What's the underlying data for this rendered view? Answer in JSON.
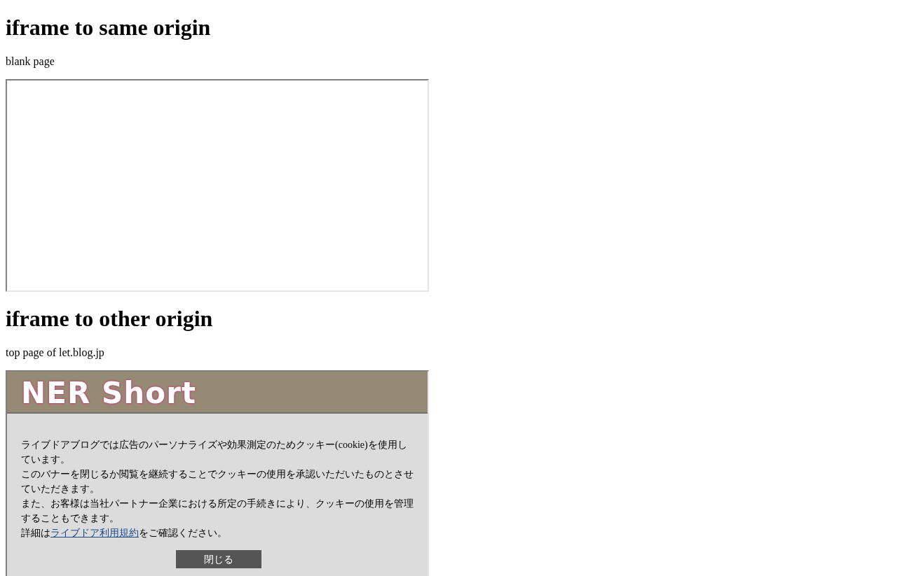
{
  "sections": [
    {
      "heading": "iframe to same origin",
      "caption": "blank page",
      "frame": {
        "kind": "blank"
      }
    },
    {
      "heading": "iframe to other origin",
      "caption": "top page of let.blog.jp",
      "frame": {
        "kind": "blog",
        "logo": "NER Short",
        "notice": {
          "lines": [
            "ライブドアブログでは広告のパーソナライズや効果測定のためクッキー(cookie)を使用しています。",
            "このバナーを閉じるか閲覧を継続することでクッキーの使用を承認いただいたものとさせていただきます。",
            "また、お客様は当社パートナー企業における所定の手続きにより、クッキーの使用を管理することもできます。"
          ],
          "details_before": "詳細は",
          "details_link": "ライブドア利用規約",
          "details_after": "をご確認ください。",
          "close_button": "閉じる"
        }
      }
    }
  ]
}
